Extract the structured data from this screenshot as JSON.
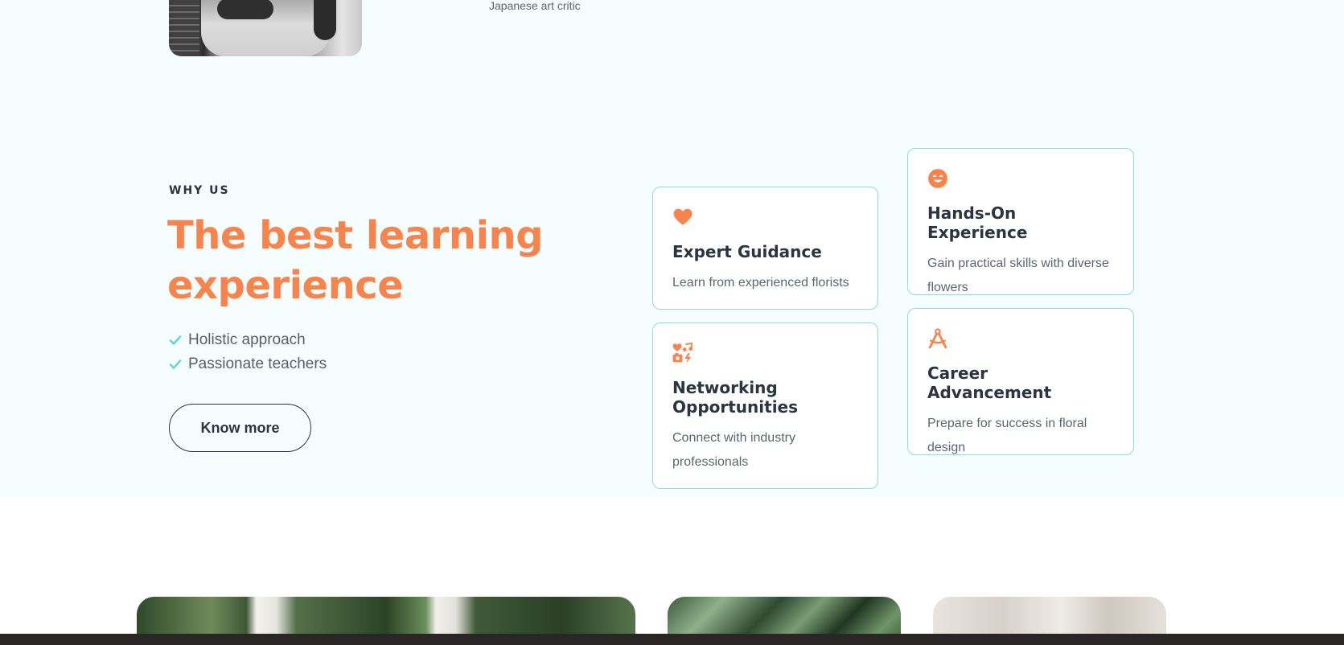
{
  "testimonial": {
    "caption": "Japanese art critic"
  },
  "why_us": {
    "eyebrow": "WHY US",
    "headline": "The best learning experience",
    "checklist": [
      "Holistic approach",
      "Passionate teachers"
    ],
    "cta_label": "Know more"
  },
  "cards": [
    {
      "icon": "heart-icon",
      "title": "Expert Guidance",
      "description": "Learn from experienced florists"
    },
    {
      "icon": "smile-icon",
      "title": "Hands-On Experience",
      "description": "Gain practical skills with diverse flowers"
    },
    {
      "icon": "networking-icon",
      "title": "Networking Opportunities",
      "description": "Connect with industry professionals"
    },
    {
      "icon": "compass-drafting-icon",
      "title": "Career Advancement",
      "description": "Prepare for success in floral design"
    }
  ],
  "colors": {
    "accent": "#f7844d",
    "check": "#5fd3cf",
    "card_border": "#8fdce0",
    "section_bg": "#f5fdfe",
    "text_dark": "#2b3440"
  }
}
